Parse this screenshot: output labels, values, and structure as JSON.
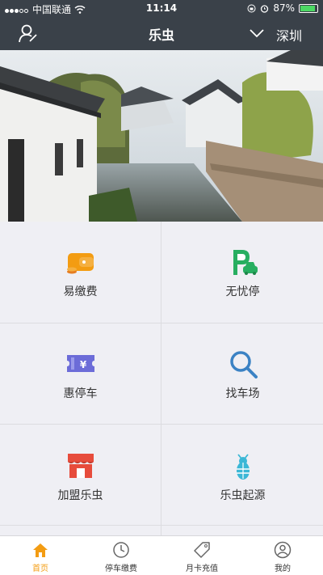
{
  "status": {
    "carrier": "中国联通",
    "time": "11:14",
    "battery": "87%"
  },
  "nav": {
    "title": "乐虫",
    "city": "深圳"
  },
  "grid": [
    {
      "label": "易缴费",
      "icon": "wallet-icon"
    },
    {
      "label": "无忧停",
      "icon": "parking-car-icon"
    },
    {
      "label": "惠停车",
      "icon": "coupon-icon"
    },
    {
      "label": "找车场",
      "icon": "search-icon"
    },
    {
      "label": "加盟乐虫",
      "icon": "store-icon"
    },
    {
      "label": "乐虫起源",
      "icon": "bug-icon"
    }
  ],
  "tabs": [
    {
      "label": "首页",
      "icon": "home-icon"
    },
    {
      "label": "停车缴费",
      "icon": "clock-icon"
    },
    {
      "label": "月卡充值",
      "icon": "tag-icon"
    },
    {
      "label": "我的",
      "icon": "profile-icon"
    }
  ],
  "colors": {
    "nav_bg": "#3a4149",
    "accent": "#f39c12",
    "green": "#27ae60",
    "purple": "#6c6cd8",
    "blue": "#3b82c4",
    "red": "#e74c3c",
    "cyan": "#3bb7d6"
  }
}
